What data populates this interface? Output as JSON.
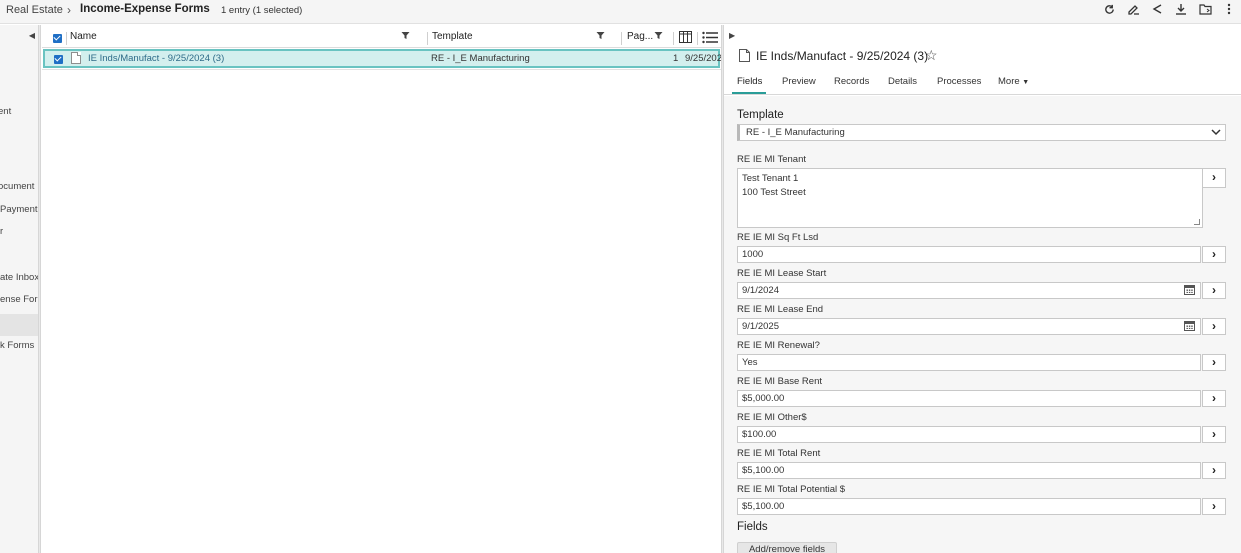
{
  "breadcrumb": {
    "root": "Real Estate",
    "separator": "›",
    "current": "Income-Expense Forms",
    "entry_count": "1 entry (1 selected)"
  },
  "toolbar_icons": [
    "refresh-icon",
    "edit-icon",
    "share-icon",
    "download-icon",
    "move-to-folder-icon",
    "more-vertical-icon"
  ],
  "left_nav": {
    "items": [
      {
        "label": "ent"
      },
      {
        "label": "ocument"
      },
      {
        "label": "Payment"
      },
      {
        "label": "r"
      },
      {
        "label": "ate Inbox"
      },
      {
        "label": "ense Forms"
      },
      {
        "label": "k Forms"
      }
    ],
    "active_index": 5
  },
  "grid": {
    "columns": {
      "name": "Name",
      "template": "Template",
      "pages": "Pag..."
    },
    "rows": [
      {
        "name": "IE Inds/Manufact - 9/25/2024 (3)",
        "template": "RE - I_E Manufacturing",
        "pages": "1",
        "date": "9/25/202"
      }
    ]
  },
  "panel": {
    "title": "IE Inds/Manufact - 9/25/2024 (3)",
    "tabs": [
      "Fields",
      "Preview",
      "Records",
      "Details",
      "Processes",
      "More"
    ],
    "active_tab": "Fields",
    "template_heading": "Template",
    "template_value": "RE - I_E Manufacturing",
    "fields": {
      "tenant": {
        "label": "RE IE MI Tenant",
        "value": "Test Tenant 1\n100 Test Street"
      },
      "sqft": {
        "label": "RE IE MI Sq Ft Lsd",
        "value": "1000"
      },
      "lease_start": {
        "label": "RE IE MI Lease Start",
        "value": "9/1/2024"
      },
      "lease_end": {
        "label": "RE IE MI Lease End",
        "value": "9/1/2025"
      },
      "renewal": {
        "label": "RE IE MI Renewal?",
        "value": "Yes"
      },
      "base_rent": {
        "label": "RE IE MI Base Rent",
        "value": "$5,000.00"
      },
      "other": {
        "label": "RE IE MI Other$",
        "value": "$100.00"
      },
      "total_rent": {
        "label": "RE IE MI Total Rent",
        "value": "$5,100.00"
      },
      "total_potential": {
        "label": "RE IE MI Total Potential $",
        "value": "$5,100.00"
      }
    },
    "fields_heading": "Fields",
    "add_remove_label": "Add/remove fields"
  },
  "colors": {
    "selection_bg": "#d3efee",
    "selection_border": "#69c3c1",
    "accent": "#2a9d98",
    "checkbox": "#1f6fc5"
  }
}
